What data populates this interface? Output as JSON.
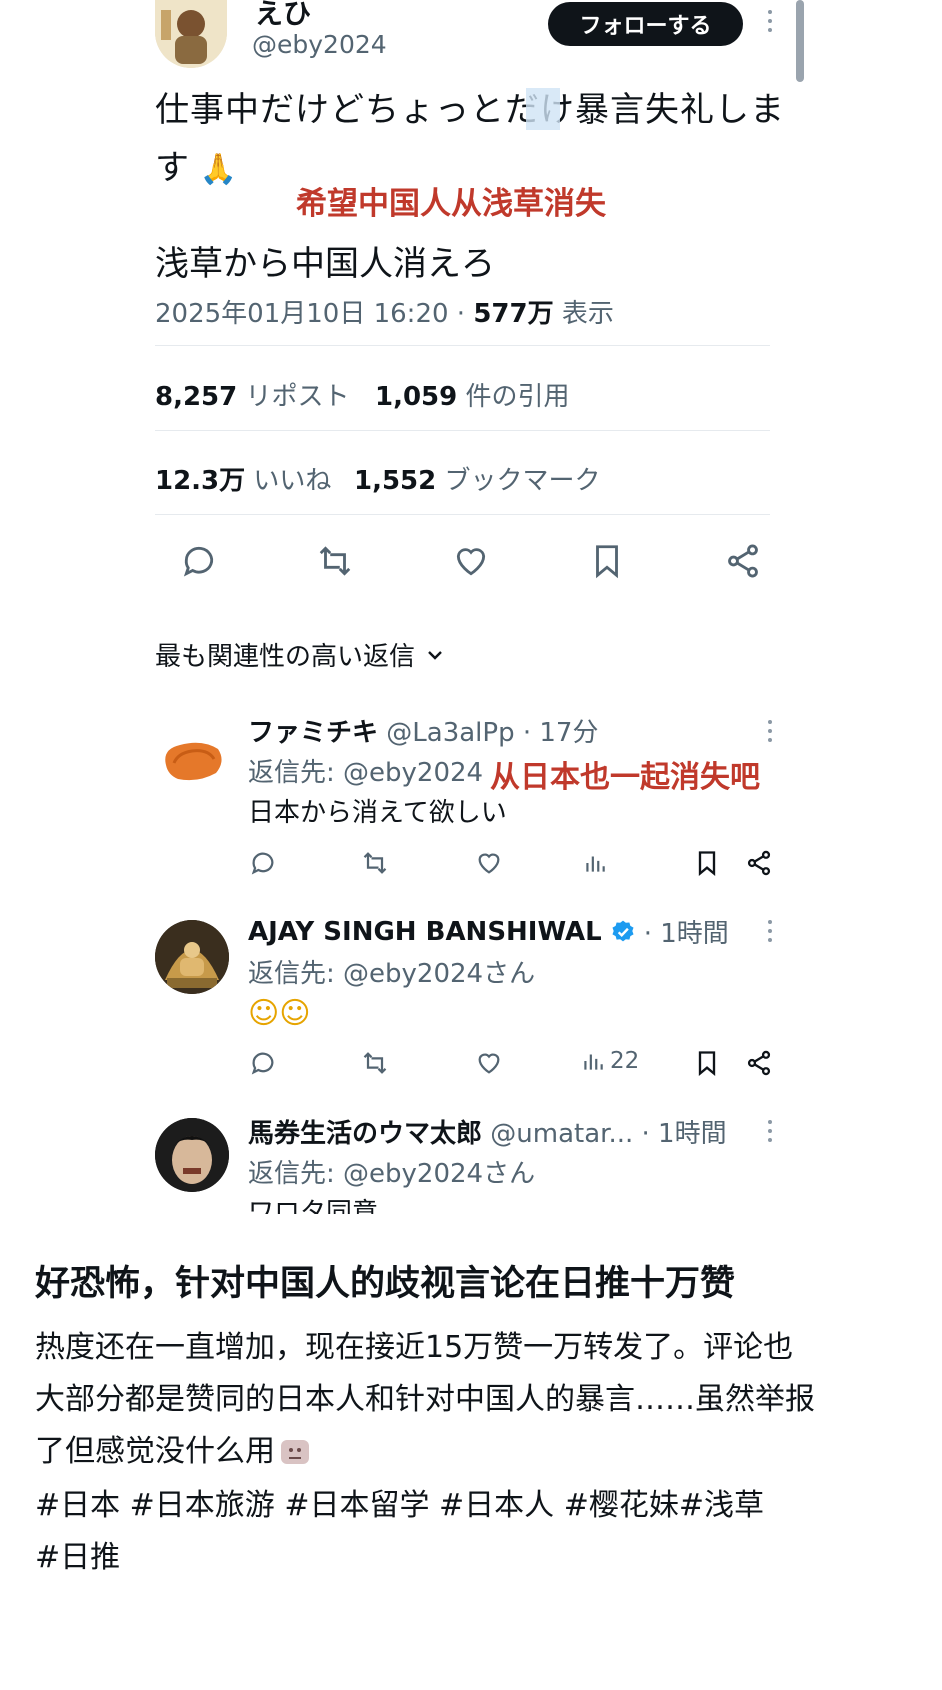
{
  "tweet": {
    "display_name": "えひ",
    "handle": "@eby2024",
    "follow_label": "フォローする",
    "text_line1": "仕事中だけどちょっとだけ暴言失礼しま",
    "text_line2": "す",
    "text_line2_emoji": "🙏",
    "text_line3": "浅草から中国人消えろ",
    "annotation": "希望中国人从浅草消失",
    "timestamp": "2025年01月10日 16:20 · ",
    "views_count": "577万",
    "views_label": " 表示",
    "stats": {
      "reposts_count": "8,257",
      "reposts_label": "リポスト",
      "quotes_count": "1,059",
      "quotes_label": "件の引用",
      "likes_count": "12.3万",
      "likes_label": "いいね",
      "bookmarks_count": "1,552",
      "bookmarks_label": "ブックマーク"
    },
    "actions": [
      "comment-icon",
      "retweet-icon",
      "heart-icon",
      "bookmark-icon",
      "share-icon"
    ]
  },
  "replies_sort": {
    "label": "最も関連性の高い返信"
  },
  "replies": [
    {
      "name": "ファミチキ",
      "handle": "@La3alPp · 17分",
      "reply_to_prefix": "返信先: ",
      "reply_to": "@eby2024",
      "text": "日本から消えて欲しい",
      "annotation": "从日本也一起消失吧",
      "views": ""
    },
    {
      "name": "AJAY SINGH BANSHIWAL",
      "verified": true,
      "time": "· 1時間",
      "reply_to_prefix": "返信先: ",
      "reply_to": "@eby2024さん",
      "text": "☺☺",
      "views": "22"
    },
    {
      "name": "馬券生活のウマ太郎",
      "handle": "@umatar...",
      "time": "· 1時間",
      "reply_to_prefix": "返信先: ",
      "reply_to": "@eby2024さん",
      "text_partial": "ワロタ同意"
    }
  ],
  "post": {
    "title": "好恐怖，针对中国人的歧视言论在日推十万赞",
    "body_line1": "热度还在一直增加，现在接近15万赞一万转发了。评论也",
    "body_line2": "大部分都是赞同的日本人和针对中国人的暴言……虽然举报",
    "body_line3": "了但感觉没什么用",
    "tags_line1": "#日本 #日本旅游 #日本留学 #日本人 #樱花妹#浅草",
    "tags_line2": "#日推"
  },
  "colors": {
    "text": "#0f1419",
    "muted": "#536471",
    "annotation": "#c0392b",
    "verified": "#1d9bf0",
    "highlight": "#cfe3f5"
  }
}
